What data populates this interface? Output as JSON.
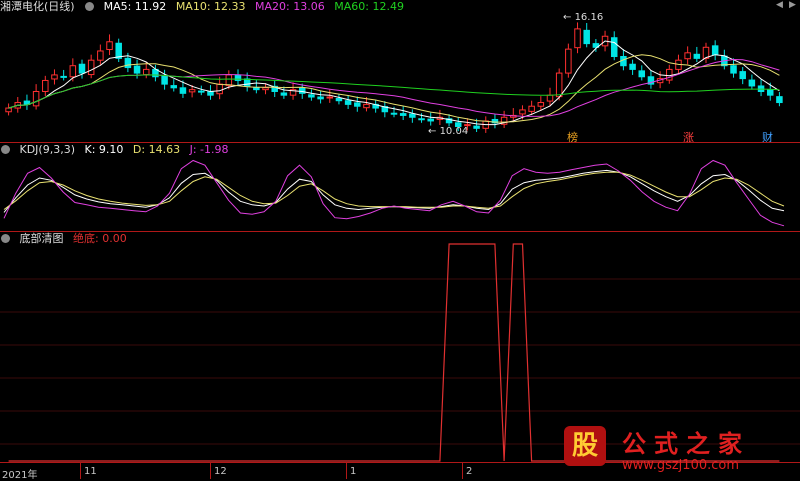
{
  "main_panel": {
    "title": "湘潭电化(日线)",
    "ma5": "MA5: 11.92",
    "ma10": "MA10: 12.33",
    "ma20": "MA20: 13.06",
    "ma60": "MA60: 12.49",
    "high_label": "16.16",
    "low_label": "10.04",
    "markers": [
      "榜",
      "涨",
      "财"
    ]
  },
  "kdj_panel": {
    "title": "KDJ(9,3,3)",
    "k": "K: 9.10",
    "d": "D: 14.63",
    "j": "J: -1.98"
  },
  "bottom_panel": {
    "title": "底部清图",
    "signal": "绝底: 0.00"
  },
  "x_axis": [
    "2021年",
    "11",
    "12",
    "1",
    "2"
  ],
  "watermark": {
    "badge": "股",
    "name": "公式之家",
    "url": "www.gszj100.com"
  },
  "colors": {
    "up": "#ff3030",
    "down": "#00e5e5",
    "ma5": "#ffffff",
    "ma10": "#e8e070",
    "ma20": "#e040e0",
    "ma60": "#20d020",
    "kdj_k": "#ffffff",
    "kdj_d": "#e8e070",
    "kdj_j": "#e040e0",
    "signal": "#e03030"
  },
  "chart_data": [
    {
      "type": "candlestick",
      "title": "湘潭电化(日线)",
      "close": [
        11.3,
        11.6,
        11.5,
        12.2,
        12.8,
        13.1,
        13.0,
        13.6,
        13.2,
        13.9,
        14.4,
        14.9,
        14.0,
        13.5,
        13.2,
        13.4,
        13.0,
        12.6,
        12.4,
        12.1,
        12.3,
        12.2,
        12.0,
        12.6,
        13.1,
        12.8,
        12.5,
        12.3,
        12.4,
        12.2,
        12.0,
        12.3,
        12.1,
        11.9,
        11.8,
        11.9,
        11.7,
        11.5,
        11.4,
        11.5,
        11.3,
        11.1,
        11.0,
        10.9,
        10.8,
        10.7,
        10.6,
        10.8,
        10.5,
        10.3,
        10.4,
        10.2,
        10.6,
        10.5,
        10.8,
        10.9,
        11.2,
        11.4,
        11.6,
        12.0,
        13.2,
        14.5,
        15.6,
        14.8,
        14.6,
        15.2,
        14.1,
        13.6,
        13.4,
        13.0,
        12.6,
        12.9,
        13.4,
        13.9,
        14.3,
        14.0,
        14.6,
        14.2,
        13.6,
        13.2,
        12.9,
        12.5,
        12.2,
        12.0,
        11.6
      ],
      "high_label": "16.16",
      "low_label": "10.04",
      "ma_lines": [
        "MA5",
        "MA10",
        "MA20",
        "MA60"
      ]
    },
    {
      "type": "line",
      "title": "KDJ(9,3,3)",
      "series": [
        {
          "name": "K",
          "values": [
            15,
            40,
            62,
            74,
            70,
            58,
            45,
            38,
            33,
            30,
            28,
            26,
            24,
            28,
            40,
            65,
            80,
            82,
            70,
            50,
            34,
            28,
            26,
            32,
            55,
            72,
            68,
            45,
            28,
            22,
            20,
            22,
            24,
            25,
            24,
            23,
            22,
            25,
            28,
            26,
            22,
            20,
            30,
            55,
            66,
            70,
            72,
            74,
            78,
            82,
            85,
            87,
            84,
            76,
            64,
            52,
            42,
            34,
            44,
            64,
            78,
            80,
            70,
            54,
            36,
            22,
            18
          ],
          "ylim": [
            -10,
            110
          ]
        },
        {
          "name": "D",
          "values": [
            20,
            35,
            52,
            66,
            68,
            62,
            52,
            44,
            38,
            34,
            31,
            29,
            27,
            28,
            34,
            52,
            68,
            76,
            72,
            58,
            44,
            34,
            30,
            31,
            44,
            60,
            64,
            52,
            38,
            30,
            26,
            25,
            25,
            25,
            25,
            24,
            24,
            24,
            26,
            26,
            24,
            22,
            26,
            42,
            56,
            64,
            68,
            71,
            75,
            79,
            82,
            84,
            84,
            79,
            70,
            60,
            50,
            42,
            42,
            54,
            68,
            74,
            72,
            62,
            48,
            34,
            26
          ],
          "ylim": [
            -10,
            110
          ]
        },
        {
          "name": "J",
          "values": [
            5,
            48,
            82,
            92,
            74,
            50,
            32,
            28,
            24,
            22,
            20,
            18,
            16,
            26,
            48,
            90,
            104,
            96,
            66,
            36,
            14,
            12,
            16,
            34,
            78,
            96,
            76,
            30,
            6,
            4,
            8,
            14,
            22,
            26,
            22,
            20,
            18,
            28,
            34,
            26,
            16,
            14,
            36,
            78,
            90,
            84,
            82,
            84,
            88,
            92,
            96,
            98,
            86,
            70,
            50,
            34,
            24,
            18,
            46,
            90,
            104,
            96,
            66,
            38,
            10,
            -2,
            -8
          ],
          "ylim": [
            -10,
            110
          ]
        }
      ],
      "k_value": 9.1,
      "d_value": 14.63,
      "j_value": -1.98
    },
    {
      "type": "line",
      "title": "底部清图",
      "series": [
        {
          "name": "绝底",
          "values": [
            0,
            0,
            0,
            0,
            0,
            0,
            0,
            0,
            0,
            0,
            0,
            0,
            0,
            0,
            0,
            0,
            0,
            0,
            0,
            0,
            0,
            0,
            0,
            0,
            0,
            0,
            0,
            0,
            0,
            0,
            0,
            0,
            0,
            0,
            0,
            0,
            0,
            0,
            0,
            0,
            0,
            0,
            0,
            0,
            0,
            0,
            0,
            0,
            1,
            1,
            1,
            1,
            1,
            1,
            0,
            1,
            1,
            0,
            0,
            0,
            0,
            0,
            0,
            0,
            0,
            0,
            0,
            0,
            0,
            0,
            0,
            0,
            0,
            0,
            0,
            0,
            0,
            0,
            0,
            0,
            0,
            0,
            0,
            0,
            0
          ]
        }
      ],
      "last_value": 0.0
    }
  ]
}
